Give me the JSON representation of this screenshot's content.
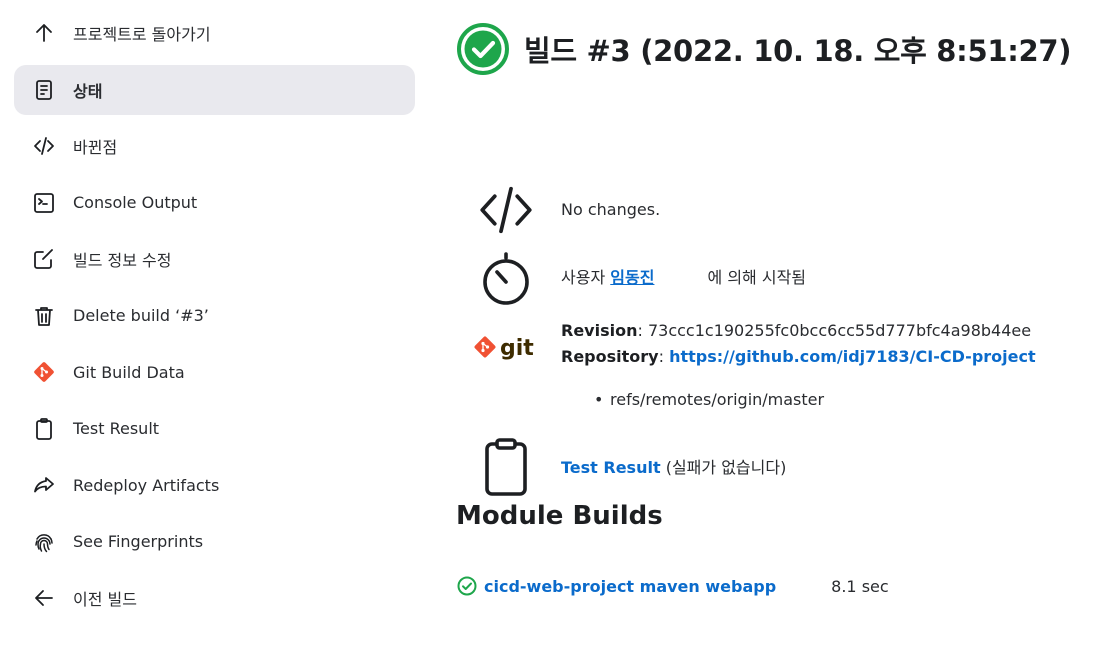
{
  "sidebar": {
    "items": [
      {
        "label": "프로젝트로 돌아가기",
        "icon": "arrow-up-icon"
      },
      {
        "label": "상태",
        "icon": "document-icon",
        "active": true
      },
      {
        "label": "바뀐점",
        "icon": "code-icon"
      },
      {
        "label": "Console Output",
        "icon": "terminal-icon"
      },
      {
        "label": "빌드 정보 수정",
        "icon": "edit-icon"
      },
      {
        "label": "Delete build ‘#3’",
        "icon": "trash-icon"
      },
      {
        "label": "Git Build Data",
        "icon": "git-icon"
      },
      {
        "label": "Test Result",
        "icon": "clipboard-icon"
      },
      {
        "label": "Redeploy Artifacts",
        "icon": "redeploy-icon"
      },
      {
        "label": "See Fingerprints",
        "icon": "fingerprint-icon"
      },
      {
        "label": "이전 빌드",
        "icon": "arrow-left-icon"
      }
    ]
  },
  "build": {
    "title": "빌드 #3 (2022. 10. 18. 오후 8:51:27)",
    "status": "success",
    "status_color": "#1ea64b"
  },
  "changes": {
    "text": "No changes."
  },
  "cause": {
    "prefix": "사용자",
    "user": "임동진",
    "suffix": "에 의해 시작됨"
  },
  "git": {
    "logo_text": "git",
    "revision_label": "Revision",
    "revision": "73ccc1c190255fc0bcc6cc55d777bfc4a98b44ee",
    "repository_label": "Repository",
    "repository": "https://github.com/idj7183/CI-CD-project",
    "branches": [
      "refs/remotes/origin/master"
    ]
  },
  "test_result": {
    "link": "Test Result",
    "note": "(실패가 없습니다)"
  },
  "modules": {
    "title": "Module Builds",
    "items": [
      {
        "name": "cicd-web-project maven webapp",
        "duration": "8.1 sec",
        "status": "success"
      }
    ]
  },
  "colors": {
    "link": "#0b6bcb",
    "success": "#1ea64b",
    "active_bg": "#e9e9ee",
    "git_orange": "#f05133"
  }
}
